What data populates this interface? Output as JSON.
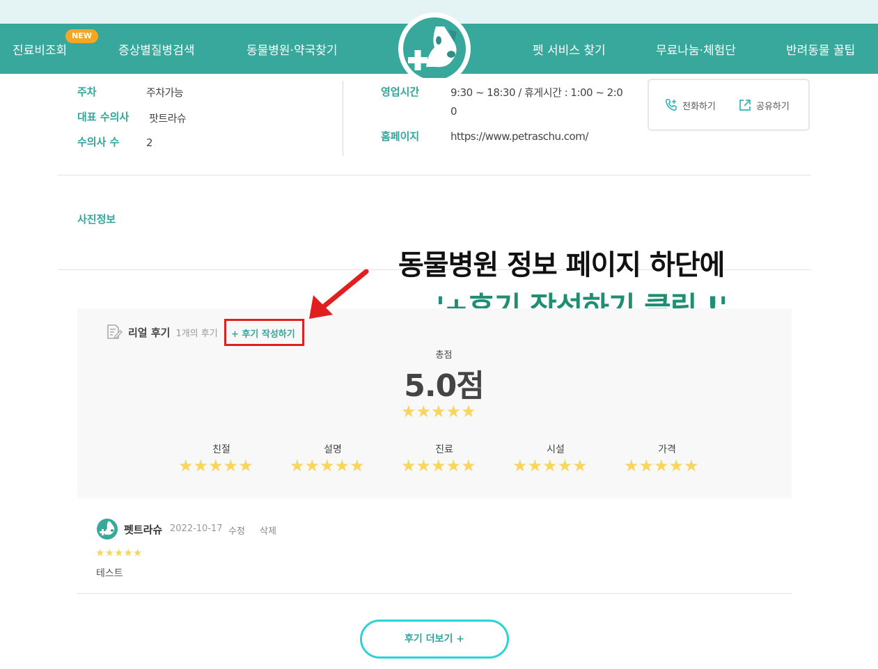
{
  "nav": {
    "items": [
      "진료비조회",
      "증상별질병검색",
      "동물병원·약국찾기",
      "펫 서비스 찾기",
      "무료나눔·체험단",
      "반려동물 꿀팁"
    ],
    "new_badge": "NEW"
  },
  "info": {
    "parking_label": "주차",
    "parking_value": "주차가능",
    "vet_label": "대표 수의사",
    "vet_value": "팟트라슈",
    "vetcount_label": "수의사 수",
    "vetcount_value": "2",
    "hours_label": "영업시간",
    "hours_value_line1": "9:30 ~ 18:30 / 휴게시간 : 1:00 ~ 2:0",
    "hours_value_line2": "0",
    "homepage_label": "홈페이지",
    "homepage_value": "https://www.petraschu.com/"
  },
  "actions": {
    "call": "전화하기",
    "share": "공유하기"
  },
  "photo_title": "사진정보",
  "annotation": {
    "line1": "동물병원 정보 페이지 하단에",
    "line2": "'+후기 작성하기 클릭 !'"
  },
  "reviews": {
    "title": "리얼 후기",
    "count": "1개의 후기",
    "write_link": "+ 후기 작성하기",
    "total_label": "총점",
    "total_score": "5.0점",
    "rating": 5,
    "categories": [
      "친절",
      "설명",
      "진료",
      "시설",
      "가격"
    ],
    "item": {
      "name": "펫트라슈",
      "date": "2022-10-17",
      "edit": "수정",
      "delete": "삭제",
      "text": "테스트"
    },
    "more_button": "후기 더보기 +"
  },
  "colors": {
    "brand": "#38a89d",
    "accent": "#2fa89c",
    "star": "#f7d55f",
    "highlight": "#e21f1f"
  }
}
